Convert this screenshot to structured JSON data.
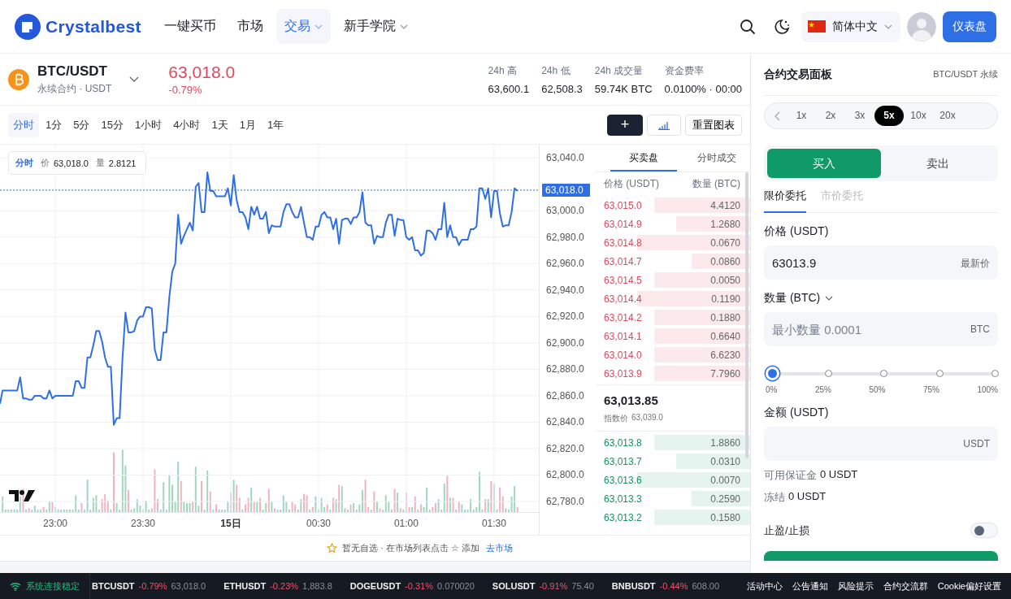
{
  "header": {
    "logo_text": "Crystalbest",
    "nav": [
      {
        "label": "一键买币",
        "selected": false,
        "dropdown": false
      },
      {
        "label": "市场",
        "selected": false,
        "dropdown": false
      },
      {
        "label": "交易",
        "selected": true,
        "dropdown": true
      },
      {
        "label": "新手学院",
        "selected": false,
        "dropdown": true
      }
    ],
    "language": "简体中文",
    "dashboard_button": "仪表盘"
  },
  "ticker": {
    "symbol": "BTC/USDT",
    "subtitle": "永续合约 · USDT",
    "price": "63,018.0",
    "change": "-0.79%",
    "stats": [
      {
        "label": "24h 高",
        "value": "63,600.1"
      },
      {
        "label": "24h 低",
        "value": "62,508.3"
      },
      {
        "label": "24h 成交量",
        "value": "59.74K BTC"
      },
      {
        "label": "资金费率",
        "value": "0.0100% · 00:00"
      }
    ]
  },
  "intervals": [
    {
      "label": "分时",
      "selected": true
    },
    {
      "label": "1分",
      "selected": false
    },
    {
      "label": "5分",
      "selected": false
    },
    {
      "label": "15分",
      "selected": false
    },
    {
      "label": "1小时",
      "selected": false
    },
    {
      "label": "4小时",
      "selected": false
    },
    {
      "label": "1天",
      "selected": false
    },
    {
      "label": "1月",
      "selected": false
    },
    {
      "label": "1年",
      "selected": false
    }
  ],
  "chart_tools": {
    "add_button": "+",
    "reset_button": "重置图表"
  },
  "chart": {
    "legend": {
      "mode": "分时",
      "price": "63,018.0",
      "volume_label": "量",
      "volume": "2.8121"
    },
    "current_price_tag": "63,018.0",
    "chart_data": {
      "type": "line",
      "grid": true,
      "ylim": [
        62772,
        63050
      ],
      "yticks": [
        {
          "value": 63040,
          "label": "63,040.0"
        },
        {
          "value": 63000,
          "label": "63,000.0"
        },
        {
          "value": 62980,
          "label": "62,980.0"
        },
        {
          "value": 62960,
          "label": "62,960.0"
        },
        {
          "value": 62940,
          "label": "62,940.0"
        },
        {
          "value": 62920,
          "label": "62,920.0"
        },
        {
          "value": 62900,
          "label": "62,900.0"
        },
        {
          "value": 62880,
          "label": "62,880.0"
        },
        {
          "value": 62860,
          "label": "62,860.0"
        },
        {
          "value": 62840,
          "label": "62,840.0"
        },
        {
          "value": 62820,
          "label": "62,820.0"
        },
        {
          "value": 62800,
          "label": "62,800.0"
        },
        {
          "value": 62780,
          "label": "62,780.0"
        }
      ],
      "categories": [
        null,
        null,
        null,
        null,
        null,
        null,
        null,
        null,
        null,
        null,
        null,
        null,
        null,
        null,
        null,
        null,
        null,
        null,
        null,
        "23:00",
        null,
        null,
        null,
        null,
        null,
        null,
        null,
        null,
        null,
        null,
        null,
        null,
        null,
        null,
        null,
        null,
        null,
        null,
        null,
        null,
        null,
        null,
        null,
        null,
        null,
        null,
        null,
        null,
        null,
        "23:30",
        null,
        null,
        null,
        null,
        null,
        null,
        null,
        null,
        null,
        null,
        null,
        null,
        null,
        null,
        null,
        null,
        null,
        null,
        null,
        null,
        null,
        null,
        null,
        null,
        null,
        null,
        null,
        null,
        null,
        "15日",
        null,
        null,
        null,
        null,
        null,
        null,
        null,
        null,
        null,
        null,
        null,
        null,
        null,
        null,
        null,
        null,
        null,
        null,
        null,
        null,
        null,
        null,
        null,
        null,
        null,
        null,
        null,
        null,
        null,
        "00:30",
        null,
        null,
        null,
        null,
        null,
        null,
        null,
        null,
        null,
        null,
        null,
        null,
        null,
        null,
        null,
        null,
        null,
        null,
        null,
        null,
        null,
        null,
        null,
        null,
        null,
        null,
        null,
        null,
        null,
        "01:00",
        null,
        null,
        null,
        null,
        null,
        null,
        null,
        null,
        null,
        null,
        null,
        null,
        null,
        null,
        null,
        null,
        null,
        null,
        null,
        null,
        null,
        null,
        null,
        null,
        null,
        null,
        null,
        null,
        null,
        "01:30",
        null,
        null,
        null,
        null,
        null,
        null,
        null,
        null
      ],
      "series": [
        {
          "name": "价",
          "color": "#2f6fe6",
          "values": [
            62854,
            62864,
            62864,
            62864,
            62864,
            62864,
            62864,
            62874,
            62858,
            62858,
            62857,
            62857,
            62860,
            62860,
            62860,
            62858,
            62858,
            62864,
            62858,
            62860,
            62860,
            62860,
            62860,
            62860,
            62860,
            62860,
            62871,
            62871,
            62866,
            62866,
            62889,
            62889,
            62898,
            62909,
            62909,
            62901,
            62889,
            62882,
            62882,
            62838,
            62843,
            62843,
            62889,
            62923,
            62908,
            62908,
            62909,
            62917,
            62920,
            62920,
            62927,
            62927,
            62926,
            62895,
            62887,
            62887,
            62908,
            62908,
            62935,
            62954,
            62960,
            62997,
            62975,
            62981,
            62986,
            62991,
            62985,
            63018,
            63021,
            62999,
            62999,
            63029,
            63015,
            63015,
            63011,
            63011,
            63011,
            63011,
            63017,
            63004,
            63027,
            63008,
            62999,
            62999,
            62995,
            62986,
            63003,
            62997,
            63003,
            62994,
            62994,
            62999,
            62983,
            62989,
            62988,
            62988,
            62988,
            62999,
            63005,
            63005,
            62999,
            62995,
            62995,
            63003,
            62991,
            62980,
            62980,
            62978,
            62988,
            62988,
            62997,
            62999,
            62995,
            62995,
            62986,
            62994,
            62975,
            62993,
            62994,
            62994,
            62990,
            62995,
            62995,
            62999,
            63014,
            62991,
            62989,
            62989,
            62975,
            62981,
            62980,
            62980,
            62991,
            62997,
            62997,
            62981,
            62994,
            62993,
            62993,
            62980,
            62978,
            62980,
            62970,
            62970,
            62966,
            62968,
            62985,
            62985,
            62983,
            62978,
            62986,
            62986,
            63006,
            62980,
            62989,
            62980,
            62980,
            62974,
            62978,
            62978,
            62978,
            62986,
            62986,
            62988,
            63017,
            63017,
            63009,
            63017,
            62995,
            63015,
            63015,
            62998,
            62988,
            62989,
            62989,
            62999,
            63017,
            63015
          ]
        }
      ]
    }
  },
  "watchlist_hint": {
    "text": "暂无自选 · 在市场列表点击 ☆ 添加",
    "link": "去市场"
  },
  "order_book": {
    "tabs": [
      {
        "label": "买卖盘",
        "selected": true
      },
      {
        "label": "分时成交",
        "selected": false
      }
    ],
    "columns": [
      "价格 (USDT)",
      "数量 (BTC)"
    ],
    "asks": [
      {
        "price": "63,015.0",
        "amount": "4.4120"
      },
      {
        "price": "63,014.9",
        "amount": "1.2680"
      },
      {
        "price": "63,014.8",
        "amount": "0.0670"
      },
      {
        "price": "63,014.7",
        "amount": "0.0860"
      },
      {
        "price": "63,014.5",
        "amount": "0.0050"
      },
      {
        "price": "63,014.4",
        "amount": "0.1190"
      },
      {
        "price": "63,014.2",
        "amount": "0.1880"
      },
      {
        "price": "63,014.1",
        "amount": "0.6640"
      },
      {
        "price": "63,014.0",
        "amount": "6.6230"
      },
      {
        "price": "63,013.9",
        "amount": "7.7960"
      }
    ],
    "last_price": "63,013.85",
    "index_label": "指数价",
    "index_price": "63,039.0",
    "bids": [
      {
        "price": "63,013.8",
        "amount": "1.8860"
      },
      {
        "price": "63,013.7",
        "amount": "0.0310"
      },
      {
        "price": "63,013.6",
        "amount": "0.0070"
      },
      {
        "price": "63,013.3",
        "amount": "0.2590"
      },
      {
        "price": "63,013.2",
        "amount": "0.1580"
      }
    ]
  },
  "trade_panel": {
    "title": "合约交易面板",
    "pair": "BTC/USDT 永续",
    "leverage": [
      {
        "label": "1x",
        "selected": false
      },
      {
        "label": "2x",
        "selected": false
      },
      {
        "label": "3x",
        "selected": false
      },
      {
        "label": "5x",
        "selected": true
      },
      {
        "label": "10x",
        "selected": false
      },
      {
        "label": "20x",
        "selected": false
      }
    ],
    "sides": [
      {
        "label": "买入",
        "selected": true
      },
      {
        "label": "卖出",
        "selected": false
      }
    ],
    "order_types": [
      {
        "label": "限价委托",
        "selected": true
      },
      {
        "label": "市价委托",
        "selected": false
      }
    ],
    "price_label": "价格 (USDT)",
    "price_value": "63013.9",
    "price_suffix": "最新价",
    "amount_label": "数量 (BTC)",
    "amount_placeholder": "最小数量 0.0001",
    "amount_suffix": "BTC",
    "slider": {
      "level": 0,
      "marks": [
        "0%",
        "25%",
        "50%",
        "75%",
        "100%"
      ]
    },
    "total_label": "金额 (USDT)",
    "total_suffix": "USDT",
    "balances": [
      {
        "label": "可用保证金",
        "value": "0 USDT"
      },
      {
        "label": "冻结",
        "value": "0 USDT"
      }
    ],
    "tp_sl": {
      "label": "止盈/止损",
      "on": false
    }
  },
  "status_bar": {
    "connection": "系统连接稳定",
    "tickers": [
      {
        "symbol": "BTCUSDT",
        "change": "-0.79%",
        "price": "63,018.0"
      },
      {
        "symbol": "ETHUSDT",
        "change": "-0.23%",
        "price": "1,883.8"
      },
      {
        "symbol": "DOGEUSDT",
        "change": "-0.31%",
        "price": "0.070020"
      },
      {
        "symbol": "SOLUSDT",
        "change": "-0.91%",
        "price": "75.40"
      },
      {
        "symbol": "BNBUSDT",
        "change": "-0.44%",
        "price": "608.00"
      }
    ],
    "links": [
      "活动中心",
      "公告通知",
      "风险提示",
      "合约交流群",
      "Cookie偏好设置"
    ]
  }
}
